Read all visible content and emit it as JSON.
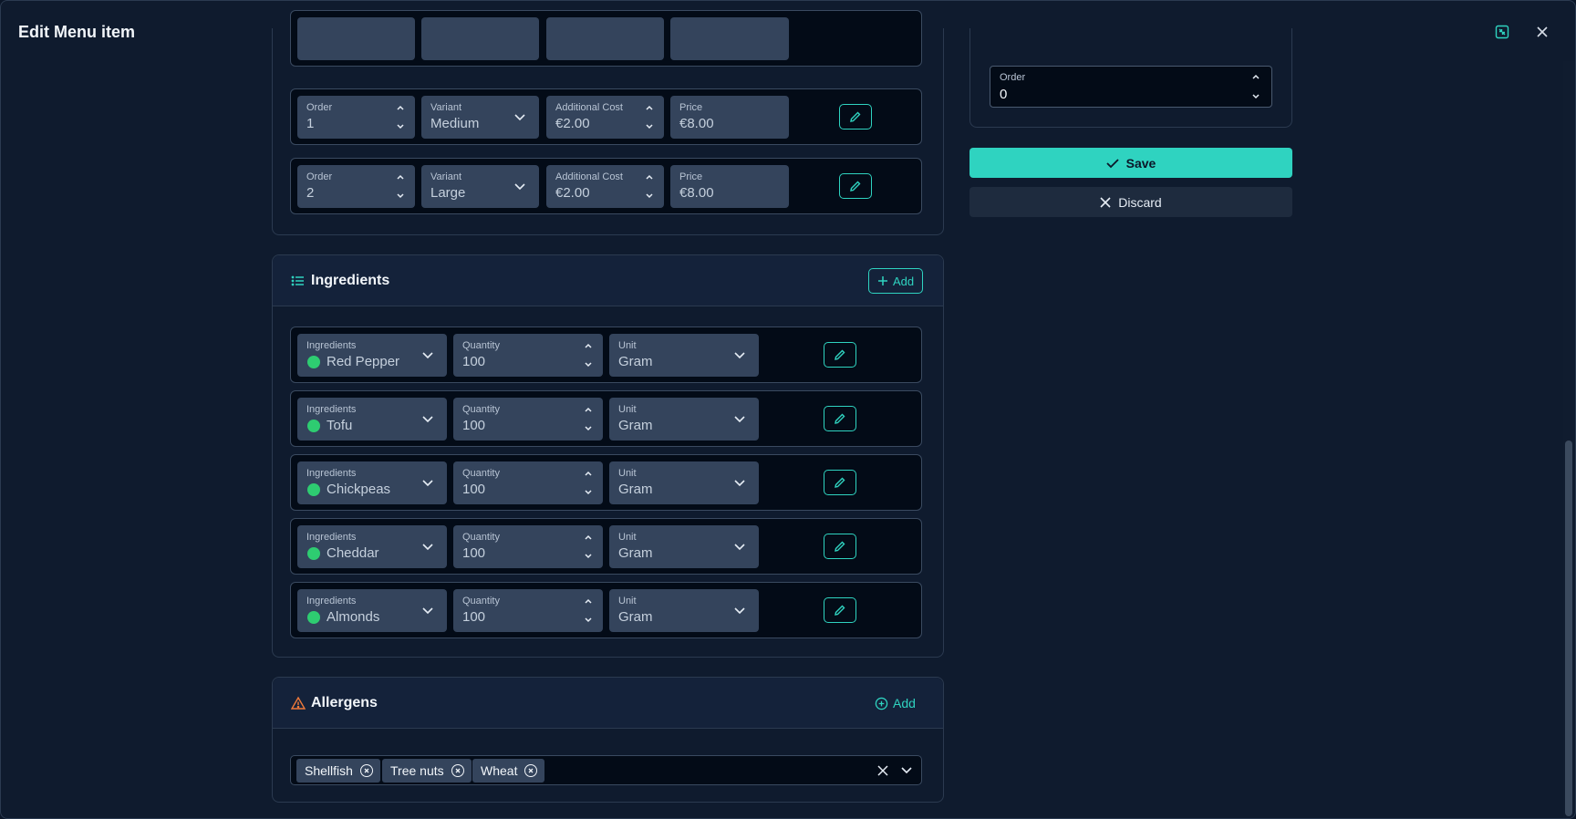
{
  "dialog": {
    "title": "Edit Menu item"
  },
  "variants": {
    "rows": [
      {
        "order_label": "Order",
        "order": "1",
        "variant_label": "Variant",
        "variant": "Medium",
        "cost_label": "Additional Cost",
        "cost": "€2.00",
        "price_label": "Price",
        "price": "€8.00"
      },
      {
        "order_label": "Order",
        "order": "2",
        "variant_label": "Variant",
        "variant": "Large",
        "cost_label": "Additional Cost",
        "cost": "€2.00",
        "price_label": "Price",
        "price": "€8.00"
      }
    ]
  },
  "ingredients": {
    "title": "Ingredients",
    "add_label": "Add",
    "rows": [
      {
        "ingredient_label": "Ingredients",
        "ingredient": "Red Pepper",
        "quantity_label": "Quantity",
        "quantity": "100",
        "unit_label": "Unit",
        "unit": "Gram"
      },
      {
        "ingredient_label": "Ingredients",
        "ingredient": "Tofu",
        "quantity_label": "Quantity",
        "quantity": "100",
        "unit_label": "Unit",
        "unit": "Gram"
      },
      {
        "ingredient_label": "Ingredients",
        "ingredient": "Chickpeas",
        "quantity_label": "Quantity",
        "quantity": "100",
        "unit_label": "Unit",
        "unit": "Gram"
      },
      {
        "ingredient_label": "Ingredients",
        "ingredient": "Cheddar",
        "quantity_label": "Quantity",
        "quantity": "100",
        "unit_label": "Unit",
        "unit": "Gram"
      },
      {
        "ingredient_label": "Ingredients",
        "ingredient": "Almonds",
        "quantity_label": "Quantity",
        "quantity": "100",
        "unit_label": "Unit",
        "unit": "Gram"
      }
    ]
  },
  "allergens": {
    "title": "Allergens",
    "add_label": "Add",
    "chips": [
      "Shellfish",
      "Tree nuts",
      "Wheat"
    ]
  },
  "sidebar": {
    "order_label": "Order",
    "order_value": "0",
    "save_label": "Save",
    "discard_label": "Discard"
  },
  "colors": {
    "accent": "#2fd3c0",
    "warning": "#f07a3a",
    "ingredient_dot": "#2ecc71",
    "background": "#0f1b2e"
  }
}
